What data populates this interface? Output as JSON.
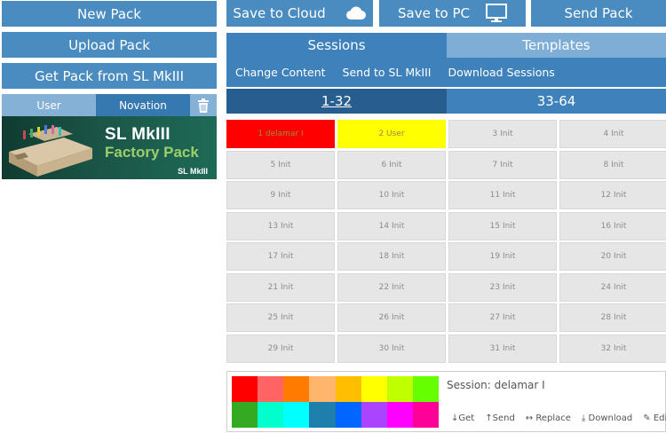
{
  "left": {
    "new_pack": "New Pack",
    "upload_pack": "Upload Pack",
    "get_pack": "Get Pack from SL MkIII",
    "tabs": {
      "user": "User",
      "novation": "Novation"
    },
    "pack": {
      "title_line1": "SL MkIII",
      "title_line2": "Factory Pack",
      "brand": "SL MkIII"
    }
  },
  "top": {
    "save_cloud": "Save to Cloud",
    "save_pc": "Save to PC",
    "send_pack": "Send Pack"
  },
  "tabs": {
    "sessions": "Sessions",
    "templates": "Templates"
  },
  "subbar": {
    "change_content": "Change Content",
    "send_to": "Send to SL MkIII",
    "download": "Download Sessions"
  },
  "ranges": {
    "first": "1-32",
    "second": "33-64"
  },
  "cells": [
    "1 delamar I",
    "2 User",
    "3 Init",
    "4 Init",
    "5 Init",
    "6 Init",
    "7 Init",
    "8 Init",
    "9 Init",
    "10 Init",
    "11 Init",
    "12 Init",
    "13 Init",
    "14 Init",
    "15 Init",
    "16 Init",
    "17 Init",
    "18 Init",
    "19 Init",
    "20 Init",
    "21 Init",
    "22 Init",
    "23 Init",
    "24 Init",
    "25 Init",
    "26 Init",
    "27 Init",
    "28 Init",
    "29 Init",
    "30 Init",
    "31 Init",
    "32 Init"
  ],
  "cell_colors": {
    "1": "#ff0000",
    "2": "#ffff00"
  },
  "palette": [
    "#ff0000",
    "#ff6363",
    "#ff7b00",
    "#ffb56b",
    "#ffbf00",
    "#ffff00",
    "#bfff00",
    "#66ff00",
    "#33aa22",
    "#00ffcc",
    "#00ffff",
    "#1e7fad",
    "#0066ff",
    "#aa44ff",
    "#ff00ff",
    "#ff0099"
  ],
  "panel": {
    "session_label": "Session: delamar I",
    "get": "Get",
    "send": "Send",
    "replace": "Replace",
    "download": "Download",
    "edit": "Edit"
  }
}
